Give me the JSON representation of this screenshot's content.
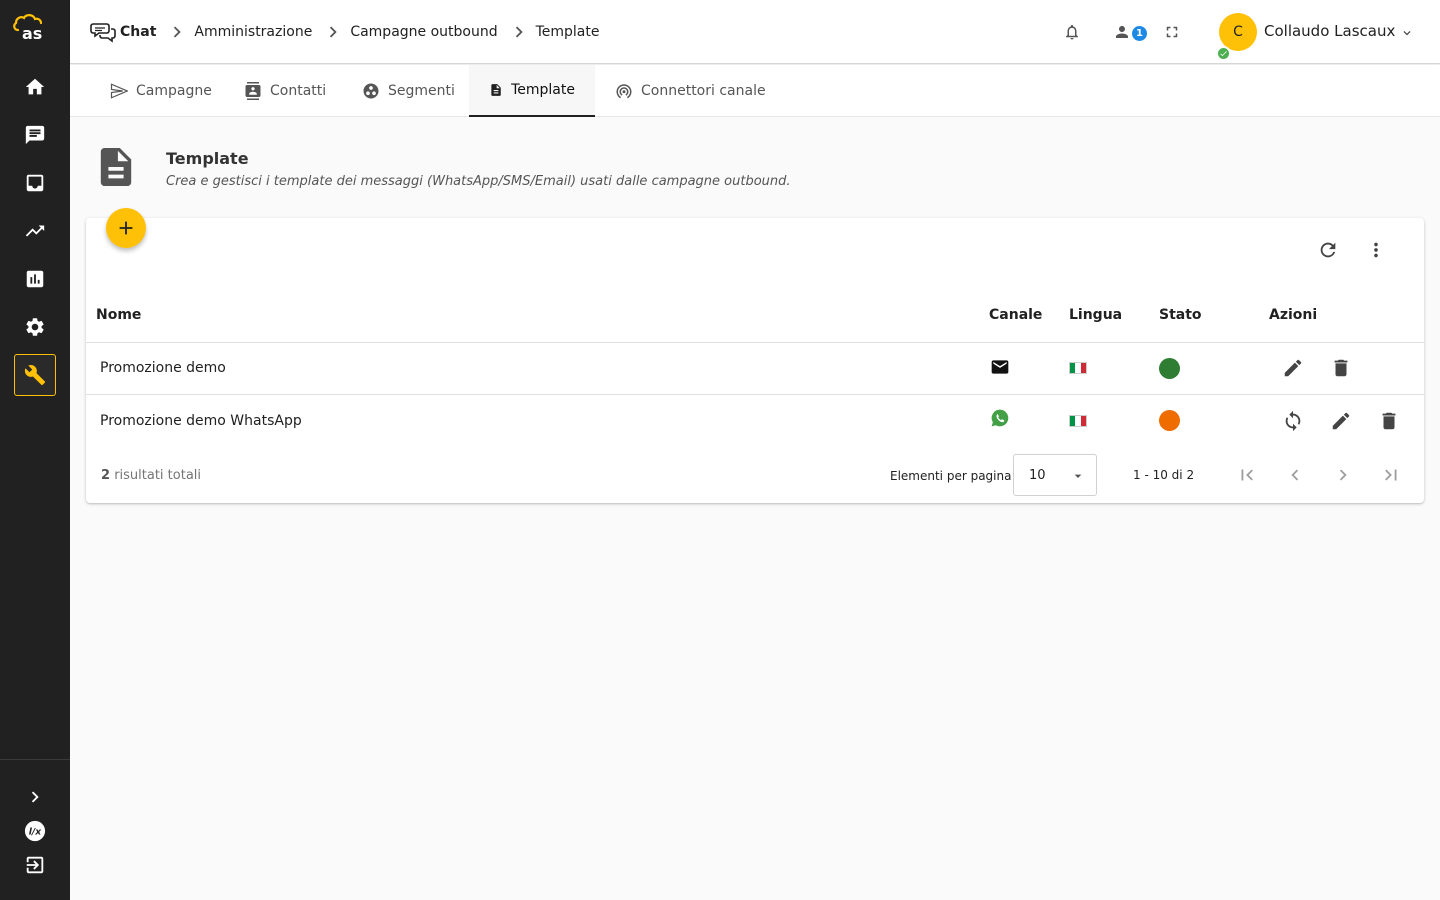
{
  "sidebar": {
    "logo_text": "as",
    "items": [
      {
        "icon": "home-icon"
      },
      {
        "icon": "chat-icon"
      },
      {
        "icon": "inbox-icon"
      },
      {
        "icon": "trending-icon"
      },
      {
        "icon": "bar-chart-icon"
      },
      {
        "icon": "gear-icon"
      },
      {
        "icon": "wrench-icon",
        "active": true
      }
    ],
    "bottom": [
      {
        "icon": "expand-chevron-icon"
      },
      {
        "icon": "lx-logo-icon"
      },
      {
        "icon": "logout-icon"
      }
    ]
  },
  "breadcrumb": [
    "Chat",
    "Amministrazione",
    "Campagne outbound",
    "Template"
  ],
  "topbar": {
    "notification_icon": "bell-icon",
    "users_icon": "person-icon",
    "users_badge": "1",
    "fullscreen_icon": "fullscreen-icon",
    "user": {
      "initial": "C",
      "name": "Collaudo Lascaux",
      "status_color": "#4caf50"
    }
  },
  "tabs": [
    {
      "label": "Campagne",
      "icon": "send-icon"
    },
    {
      "label": "Contatti",
      "icon": "contacts-icon"
    },
    {
      "label": "Segmenti",
      "icon": "segments-icon"
    },
    {
      "label": "Template",
      "icon": "document-icon",
      "active": true
    },
    {
      "label": "Connettori canale",
      "icon": "antenna-icon"
    }
  ],
  "page": {
    "title": "Template",
    "subtitle": "Crea e gestisci i template dei messaggi (WhatsApp/SMS/Email) usati dalle campagne outbound."
  },
  "table": {
    "columns": [
      "Nome",
      "Canale",
      "Lingua",
      "Stato",
      "Azioni"
    ],
    "rows": [
      {
        "name": "Promozione demo",
        "channel": "email-icon",
        "language": "it",
        "status_color": "#2e7d32",
        "actions": [
          "edit-icon",
          "delete-icon"
        ]
      },
      {
        "name": "Promozione demo WhatsApp",
        "channel": "whatsapp-icon",
        "language": "it",
        "status_color": "#ef6c00",
        "actions": [
          "sync-icon",
          "edit-icon",
          "delete-icon"
        ]
      }
    ]
  },
  "footer": {
    "total_count": "2",
    "total_label": "risultati totali",
    "per_page_label": "Elementi per pagina",
    "per_page_value": "10",
    "range": "1 - 10 di 2"
  },
  "colors": {
    "accent": "#ffc107",
    "sidebar": "#212121",
    "badge": "#1e88e5"
  }
}
